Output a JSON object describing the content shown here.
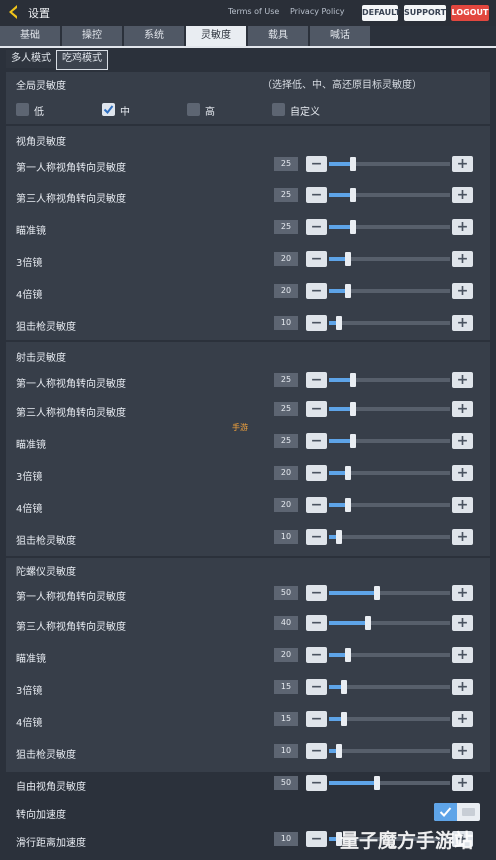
{
  "header": {
    "title": "设置",
    "links": [
      "Terms of Use",
      "Privacy Policy"
    ],
    "buttons": [
      "DEFAULT",
      "SUPPORT",
      "LOGOUT"
    ]
  },
  "tabs": [
    "基础",
    "操控",
    "系统",
    "灵敏度",
    "载具",
    "喊话"
  ],
  "mode_tabs": [
    "多人模式",
    "吃鸡模式"
  ],
  "global": {
    "title": "全局灵敏度",
    "hint": "（选择低、中、高还原目标灵敏度）",
    "options": [
      "低",
      "中",
      "高",
      "自定义"
    ],
    "selected": "中"
  },
  "sections": [
    {
      "title": "视角灵敏度",
      "rows": [
        {
          "label": "第一人称视角转向灵敏度",
          "value": 25,
          "display": "25"
        },
        {
          "label": "第三人称视角转向灵敏度",
          "value": 25,
          "display": "25"
        },
        {
          "label": "瞄准镜",
          "value": 25,
          "display": "25"
        },
        {
          "label": "3倍镜",
          "value": 20,
          "display": "20"
        },
        {
          "label": "4倍镜",
          "value": 20,
          "display": "20"
        },
        {
          "label": "狙击枪灵敏度",
          "value": 10,
          "display": "10"
        }
      ]
    },
    {
      "title": "射击灵敏度",
      "rows": [
        {
          "label": "第一人称视角转向灵敏度",
          "value": 25,
          "display": "25"
        },
        {
          "label": "第三人称视角转向灵敏度",
          "value": 25,
          "display": "25"
        },
        {
          "label": "瞄准镜",
          "value": 25,
          "display": "25"
        },
        {
          "label": "3倍镜",
          "value": 20,
          "display": "20"
        },
        {
          "label": "4倍镜",
          "value": 20,
          "display": "20"
        },
        {
          "label": "狙击枪灵敏度",
          "value": 10,
          "display": "10"
        }
      ]
    },
    {
      "title": "陀螺仪灵敏度",
      "rows": [
        {
          "label": "第一人称视角转向灵敏度",
          "value": 50,
          "display": "50"
        },
        {
          "label": "第三人称视角转向灵敏度",
          "value": 40,
          "display": "40"
        },
        {
          "label": "瞄准镜",
          "value": 20,
          "display": "20"
        },
        {
          "label": "3倍镜",
          "value": 15,
          "display": "15"
        },
        {
          "label": "4倍镜",
          "value": 15,
          "display": "15"
        },
        {
          "label": "狙击枪灵敏度",
          "value": 10,
          "display": "10"
        }
      ]
    }
  ],
  "free_look": {
    "label": "自由视角灵敏度",
    "value": 50,
    "display": "50"
  },
  "turn_accel": {
    "label": "转向加速度",
    "enabled": true
  },
  "slide": {
    "label": "滑行距离加速度",
    "value": 10,
    "display": "10"
  },
  "slider_max": 125,
  "watermark": "量子魔方手游站",
  "logo_text": "手游"
}
